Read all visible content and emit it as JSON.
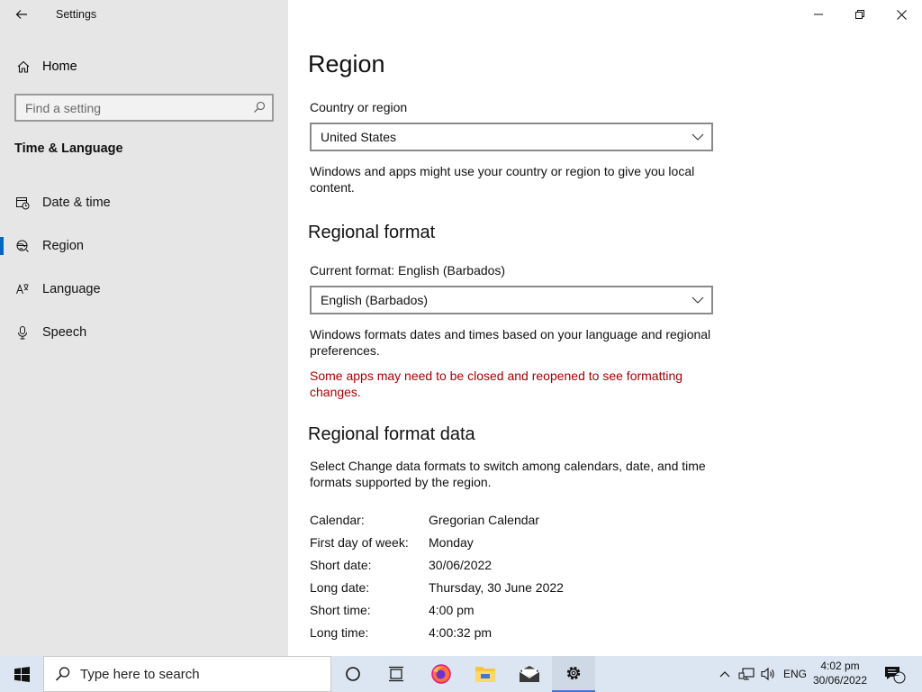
{
  "window": {
    "app_title": "Settings"
  },
  "sidebar": {
    "home_label": "Home",
    "search_placeholder": "Find a setting",
    "section_title": "Time & Language",
    "items": [
      {
        "label": "Date & time",
        "icon": "calendar-clock-icon"
      },
      {
        "label": "Region",
        "icon": "globe-icon",
        "active": true
      },
      {
        "label": "Language",
        "icon": "language-icon"
      },
      {
        "label": "Speech",
        "icon": "microphone-icon"
      }
    ]
  },
  "main": {
    "title": "Region",
    "country": {
      "label": "Country or region",
      "selected": "United States",
      "description": "Windows and apps might use your country or region to give you local content."
    },
    "regional_format": {
      "heading": "Regional format",
      "current_label": "Current format: English (Barbados)",
      "selected": "English (Barbados)",
      "description": "Windows formats dates and times based on your language and regional preferences.",
      "warning": "Some apps may need to be closed and reopened to see formatting changes.",
      "warning_color": "#a80000"
    },
    "format_data": {
      "heading": "Regional format data",
      "description": "Select Change data formats to switch among calendars, date, and time formats supported by the region.",
      "rows": [
        {
          "key": "Calendar:",
          "value": "Gregorian Calendar"
        },
        {
          "key": "First day of week:",
          "value": "Monday"
        },
        {
          "key": "Short date:",
          "value": "30/06/2022"
        },
        {
          "key": "Long date:",
          "value": "Thursday, 30 June 2022"
        },
        {
          "key": "Short time:",
          "value": "4:00 pm"
        },
        {
          "key": "Long time:",
          "value": "4:00:32 pm"
        }
      ]
    }
  },
  "taskbar": {
    "search_placeholder": "Type here to search",
    "language": "ENG",
    "time": "4:02 pm",
    "date": "30/06/2022",
    "notification_count": "2",
    "accent_color": "#0067c0"
  }
}
